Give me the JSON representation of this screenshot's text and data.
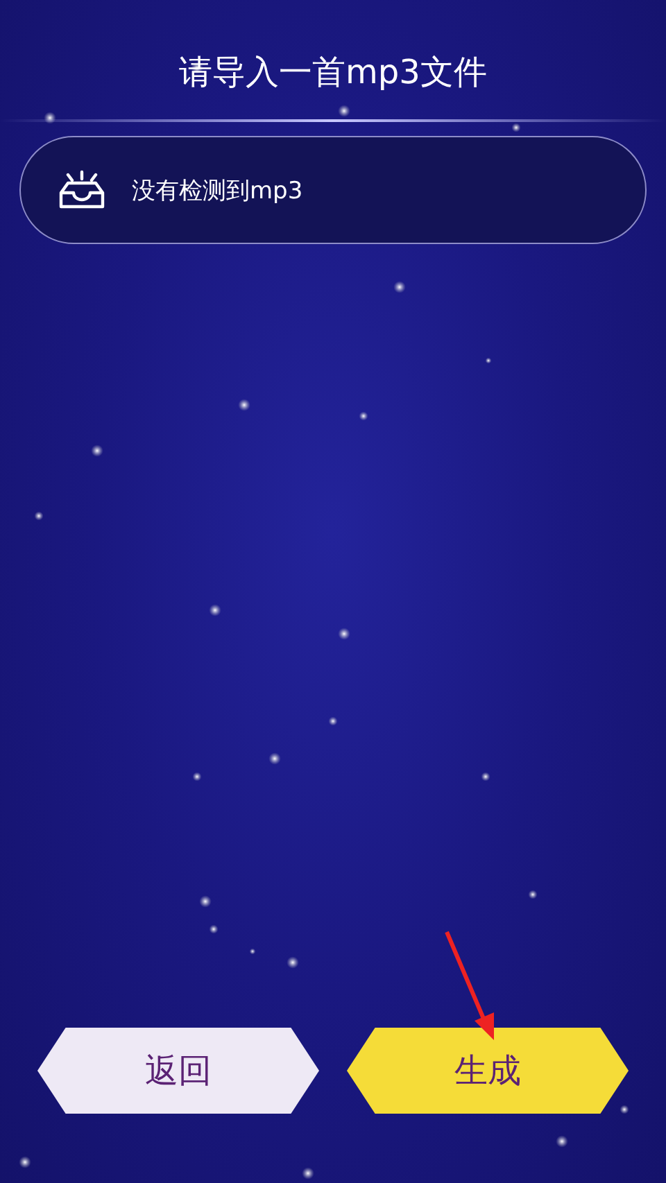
{
  "title": "请导入一首mp3文件",
  "file_status": {
    "message": "没有检测到mp3"
  },
  "buttons": [
    {
      "label": "返回",
      "kind": "secondary"
    },
    {
      "label": "生成",
      "kind": "primary"
    }
  ]
}
